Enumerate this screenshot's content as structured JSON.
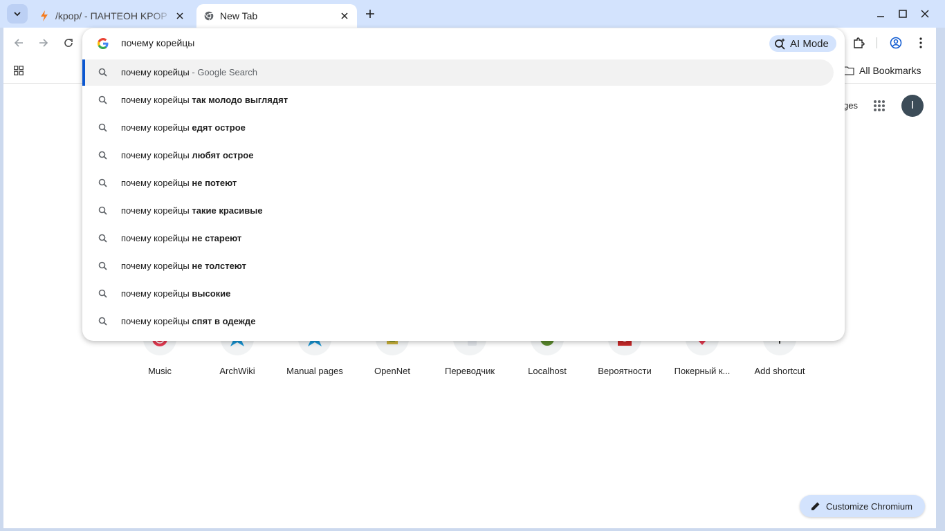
{
  "browser": {
    "tabs": [
      {
        "title": "/kpop/ - ПАНТЕОН KPOP",
        "active": false,
        "icon": "lightning-icon"
      },
      {
        "title": "New Tab",
        "active": true,
        "icon": "chromium-icon"
      }
    ]
  },
  "omnibox": {
    "query": "почему корейцы",
    "ai_mode_label": "AI Mode",
    "top_suggestion": {
      "prefix": "почему корейцы",
      "suffix": " - Google Search"
    },
    "suggestions": [
      {
        "prefix": "почему корейцы",
        "bold": "так молодо выглядят"
      },
      {
        "prefix": "почему корейцы",
        "bold": "едят острое"
      },
      {
        "prefix": "почему корейцы",
        "bold": "любят острое"
      },
      {
        "prefix": "почему корейцы",
        "bold": "не потеют"
      },
      {
        "prefix": "почему корейцы",
        "bold": "такие красивые"
      },
      {
        "prefix": "почему корейцы",
        "bold": "не стареют"
      },
      {
        "prefix": "почему корейцы",
        "bold": "не толстеют"
      },
      {
        "prefix": "почему корейцы",
        "bold": "высокие"
      },
      {
        "prefix": "почему корейцы",
        "bold": "спят в одежде"
      }
    ]
  },
  "bookmarks": {
    "all_bookmarks_label": "All Bookmarks"
  },
  "ntp": {
    "header_partial_link": "ges",
    "avatar_letter": "I",
    "shortcuts": [
      {
        "label": "Music"
      },
      {
        "label": "ArchWiki"
      },
      {
        "label": "Manual pages"
      },
      {
        "label": "OpenNet"
      },
      {
        "label": "Переводчик"
      },
      {
        "label": "Localhost"
      },
      {
        "label": "Вероятности"
      },
      {
        "label": "Покерный к..."
      },
      {
        "label": "Add shortcut"
      }
    ],
    "customize_label": "Customize Chromium"
  },
  "colors": {
    "accent": "#0b57d0",
    "tabstrip": "#d3e3fd",
    "chip": "#d3e3fd"
  }
}
